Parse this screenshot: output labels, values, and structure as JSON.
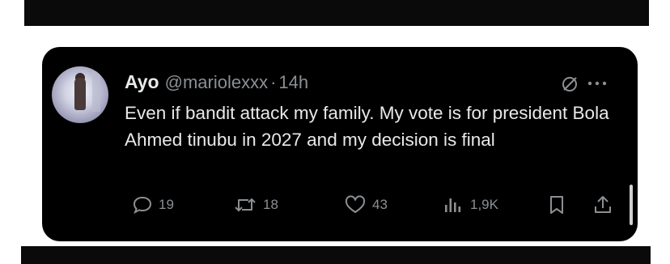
{
  "tweet": {
    "author_name": "Ayo",
    "handle": "@mariolexxx",
    "separator": "·",
    "time": "14h",
    "text": "Even if bandit attack my family. My vote is for president Bola Ahmed tinubu in 2027 and my decision is final"
  },
  "actions": {
    "replies": "19",
    "reposts": "18",
    "likes": "43",
    "views": "1,9K"
  },
  "icons": {
    "header": [
      "grok-icon",
      "more-options-icon"
    ],
    "actions": [
      "reply-icon",
      "repost-icon",
      "like-icon",
      "views-icon",
      "bookmark-icon",
      "share-icon"
    ]
  },
  "colors": {
    "card_background": "#000000",
    "primary_text": "#e7e9ea",
    "secondary_text": "#8b8f93"
  }
}
